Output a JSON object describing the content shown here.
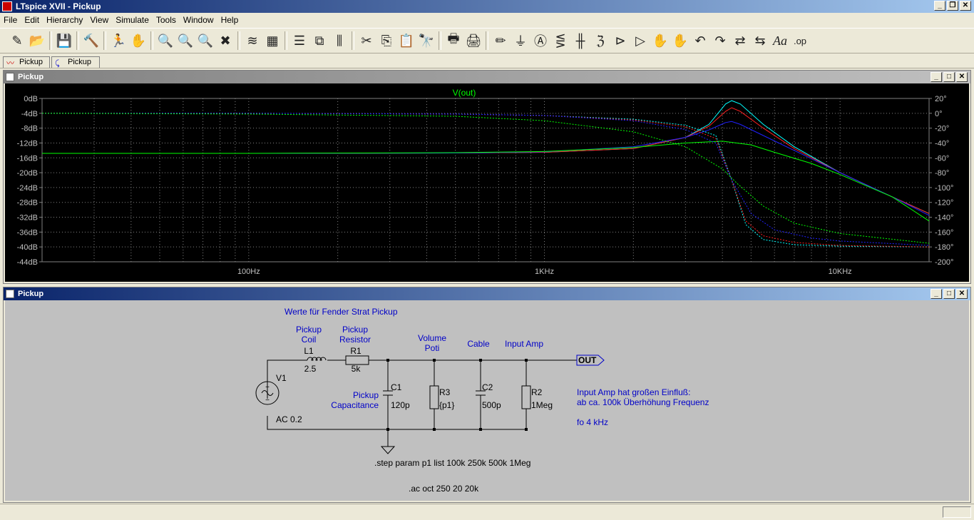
{
  "window": {
    "title": "LTspice XVII - Pickup"
  },
  "menu": [
    "File",
    "Edit",
    "Hierarchy",
    "View",
    "Simulate",
    "Tools",
    "Window",
    "Help"
  ],
  "toolbar": {
    "icons": [
      "new-schematic",
      "open",
      "save",
      "control-panel",
      "run",
      "halt",
      "zoom-in",
      "pan",
      "zoom-out",
      "zoom-cancel",
      "autorange",
      "grid",
      "tile-horizontal",
      "cascade",
      "tile-vertical",
      "cut",
      "copy",
      "paste",
      "find",
      "print-preview",
      "print",
      "draw-wire",
      "ground",
      "label-net",
      "resistor",
      "capacitor",
      "inductor",
      "diode",
      "component",
      "move",
      "drag",
      "undo",
      "redo",
      "rotate",
      "mirror",
      "text",
      "spice-directive"
    ],
    "glyphs": [
      "✎",
      "📂",
      "💾",
      "🔨",
      "🏃",
      "✋",
      "🔍",
      "🔍",
      "🔍",
      "✖",
      "≋",
      "▦",
      "☰",
      "⧉",
      "⫼",
      "✂",
      "⎘",
      "📋",
      "🔭",
      "🖶",
      "🖨",
      "✏",
      "⏚",
      "Ⓐ",
      "⋚",
      "╫",
      "ℨ",
      "⊳",
      "▷",
      "✋",
      "✋",
      "↶",
      "↷",
      "⇄",
      "⇆",
      "Aa",
      ".op"
    ]
  },
  "tabs": [
    {
      "label": "Pickup",
      "icon": "waveform-icon"
    },
    {
      "label": "Pickup",
      "icon": "schematic-icon"
    }
  ],
  "plot_window": {
    "title": "Pickup"
  },
  "schematic_window": {
    "title": "Pickup"
  },
  "chart_data": {
    "type": "line",
    "title": "V(out)",
    "x_scale": "log",
    "xlim": [
      20,
      20000
    ],
    "x_tick_labels": [
      {
        "value": 100,
        "label": "100Hz"
      },
      {
        "value": 1000,
        "label": "1KHz"
      },
      {
        "value": 10000,
        "label": "10KHz"
      }
    ],
    "y_left": {
      "lim": [
        -44,
        0
      ],
      "ticks": [
        "0dB",
        "-4dB",
        "-8dB",
        "-12dB",
        "-16dB",
        "-20dB",
        "-24dB",
        "-28dB",
        "-32dB",
        "-36dB",
        "-40dB",
        "-44dB"
      ]
    },
    "y_right": {
      "lim": [
        -200,
        20
      ],
      "ticks": [
        "20°",
        "0°",
        "-20°",
        "-40°",
        "-60°",
        "-80°",
        "-100°",
        "-120°",
        "-140°",
        "-160°",
        "-180°",
        "-200°"
      ]
    },
    "grid": true,
    "series": [
      {
        "kind": "magnitude",
        "color": "#00ffff",
        "points": [
          [
            20,
            -14.8
          ],
          [
            100,
            -14.8
          ],
          [
            500,
            -14.7
          ],
          [
            1000,
            -14.5
          ],
          [
            2000,
            -13.5
          ],
          [
            3000,
            -10.5
          ],
          [
            3600,
            -7
          ],
          [
            4100,
            -1.5
          ],
          [
            4300,
            -0.6
          ],
          [
            4600,
            -1.5
          ],
          [
            5500,
            -7
          ],
          [
            7000,
            -13
          ],
          [
            10000,
            -20
          ],
          [
            15000,
            -26.5
          ],
          [
            20000,
            -31
          ]
        ]
      },
      {
        "kind": "magnitude",
        "color": "#ff2020",
        "points": [
          [
            20,
            -14.8
          ],
          [
            100,
            -14.8
          ],
          [
            500,
            -14.7
          ],
          [
            1000,
            -14.5
          ],
          [
            2000,
            -13.5
          ],
          [
            3000,
            -10.5
          ],
          [
            3600,
            -7.5
          ],
          [
            4100,
            -3.5
          ],
          [
            4300,
            -2.5
          ],
          [
            4600,
            -3.5
          ],
          [
            5500,
            -8
          ],
          [
            7000,
            -13.5
          ],
          [
            10000,
            -20
          ],
          [
            15000,
            -26.5
          ],
          [
            20000,
            -31
          ]
        ]
      },
      {
        "kind": "magnitude",
        "color": "#2020ff",
        "points": [
          [
            20,
            -14.8
          ],
          [
            100,
            -14.8
          ],
          [
            500,
            -14.7
          ],
          [
            1000,
            -14.4
          ],
          [
            2000,
            -13
          ],
          [
            3000,
            -10.5
          ],
          [
            3600,
            -8.5
          ],
          [
            4100,
            -6.5
          ],
          [
            4300,
            -6.2
          ],
          [
            4600,
            -7
          ],
          [
            5500,
            -10
          ],
          [
            7000,
            -14
          ],
          [
            10000,
            -20
          ],
          [
            15000,
            -26.5
          ],
          [
            20000,
            -31.5
          ]
        ]
      },
      {
        "kind": "magnitude",
        "color": "#00ff00",
        "points": [
          [
            20,
            -14.8
          ],
          [
            100,
            -14.8
          ],
          [
            500,
            -14.6
          ],
          [
            1000,
            -14.3
          ],
          [
            2000,
            -13.2
          ],
          [
            3000,
            -12
          ],
          [
            4000,
            -11.5
          ],
          [
            5000,
            -12.5
          ],
          [
            6000,
            -14.5
          ],
          [
            8000,
            -17.5
          ],
          [
            10000,
            -20.5
          ],
          [
            15000,
            -26.5
          ],
          [
            20000,
            -33
          ]
        ]
      },
      {
        "kind": "phase",
        "color": "#00ffff",
        "points": [
          [
            20,
            0
          ],
          [
            100,
            0
          ],
          [
            500,
            -1
          ],
          [
            1000,
            -3
          ],
          [
            2000,
            -8
          ],
          [
            3000,
            -16
          ],
          [
            3800,
            -30
          ],
          [
            4300,
            -90
          ],
          [
            4800,
            -150
          ],
          [
            5500,
            -170
          ],
          [
            7000,
            -177
          ],
          [
            10000,
            -179
          ],
          [
            20000,
            -180
          ]
        ]
      },
      {
        "kind": "phase",
        "color": "#ff2020",
        "points": [
          [
            20,
            0
          ],
          [
            100,
            0
          ],
          [
            500,
            -1
          ],
          [
            1000,
            -3
          ],
          [
            2000,
            -9
          ],
          [
            3000,
            -18
          ],
          [
            3800,
            -34
          ],
          [
            4300,
            -90
          ],
          [
            4800,
            -145
          ],
          [
            5500,
            -165
          ],
          [
            7000,
            -174
          ],
          [
            10000,
            -178
          ],
          [
            20000,
            -180
          ]
        ]
      },
      {
        "kind": "phase",
        "color": "#2020ff",
        "points": [
          [
            20,
            0
          ],
          [
            100,
            0
          ],
          [
            500,
            -1
          ],
          [
            1000,
            -3
          ],
          [
            2000,
            -10
          ],
          [
            3000,
            -22
          ],
          [
            3800,
            -40
          ],
          [
            4300,
            -90
          ],
          [
            5000,
            -135
          ],
          [
            6000,
            -157
          ],
          [
            8000,
            -168
          ],
          [
            10000,
            -172
          ],
          [
            20000,
            -178
          ]
        ]
      },
      {
        "kind": "phase",
        "color": "#00ff00",
        "points": [
          [
            20,
            0
          ],
          [
            100,
            -1
          ],
          [
            500,
            -4
          ],
          [
            1000,
            -10
          ],
          [
            2000,
            -25
          ],
          [
            3000,
            -45
          ],
          [
            4000,
            -75
          ],
          [
            4500,
            -95
          ],
          [
            5500,
            -125
          ],
          [
            7000,
            -148
          ],
          [
            10000,
            -162
          ],
          [
            20000,
            -175
          ]
        ]
      }
    ]
  },
  "schematic": {
    "header": "Werte für Fender Strat Pickup",
    "source": {
      "name": "V1",
      "value": "AC 0.2"
    },
    "inductor": {
      "title1": "Pickup",
      "title2": "Coil",
      "name": "L1",
      "value": "2.5"
    },
    "resistor1": {
      "title1": "Pickup",
      "title2": "Resistor",
      "name": "R1",
      "value": "5k"
    },
    "capacitor1": {
      "title1": "Pickup",
      "title2": "Capacitance",
      "name": "C1",
      "value": "120p"
    },
    "volume": {
      "title1": "Volume",
      "title2": "Poti",
      "name": "R3",
      "value": "{p1}"
    },
    "cable": {
      "title": "Cable",
      "name": "C2",
      "value": "500p"
    },
    "input_amp": {
      "title": "Input Amp",
      "name": "R2",
      "value": "1Meg"
    },
    "out_label": "OUT",
    "note1": "Input Amp hat großen Einfluß:",
    "note2": "ab ca. 100k Überhöhung Frequenz",
    "note3": "fo 4 kHz",
    "step_directive": ".step param p1 list 100k 250k 500k 1Meg",
    "ac_directive": ".ac oct 250 20 20k"
  }
}
